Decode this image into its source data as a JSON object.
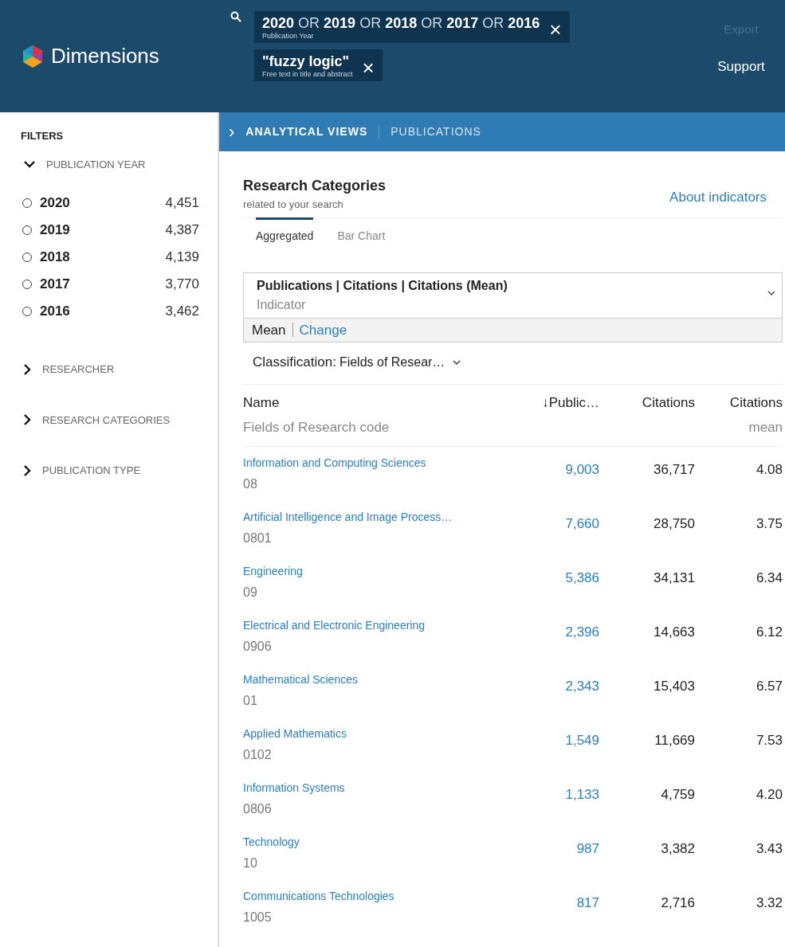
{
  "header": {
    "logo": "Dimensions",
    "search_chips": [
      {
        "query": "**2020** OR **2019** OR **2018** OR **2017** OR **2016**",
        "caption": "Publication Year",
        "remove": "×"
      },
      {
        "query": "\"fuzzy logic\"",
        "caption": "Free text in title and abstract",
        "remove": "×"
      }
    ],
    "links": [
      {
        "label": "Export",
        "disabled": true
      },
      {
        "label": "Support",
        "disabled": false
      }
    ]
  },
  "breadcrumb": {
    "toggle": "›",
    "items": [
      "ANALYTICAL VIEWS",
      "PUBLICATIONS"
    ]
  },
  "sidebar": {
    "title": "FILTERS",
    "sections": [
      {
        "label": "PUBLICATION YEAR",
        "expanded": true,
        "items": [
          {
            "label": "2020",
            "count": "4,451",
            "checked": false
          },
          {
            "label": "2019",
            "count": "4,387",
            "checked": false
          },
          {
            "label": "2018",
            "count": "4,139",
            "checked": false
          },
          {
            "label": "2017",
            "count": "3,770",
            "checked": false
          },
          {
            "label": "2016",
            "count": "3,462",
            "checked": false
          }
        ]
      },
      {
        "label": "RESEARCHER",
        "expanded": false
      },
      {
        "label": "RESEARCH CATEGORIES",
        "expanded": false
      },
      {
        "label": "PUBLICATION TYPE",
        "expanded": false
      }
    ]
  },
  "panel": {
    "title": "Research Categories",
    "subtitle": "related to your search",
    "about_link": "About indicators",
    "tabs": [
      {
        "label": "Aggregated",
        "selected": true
      },
      {
        "label": "Bar Chart",
        "selected": false
      }
    ],
    "indicator": {
      "value": "Publications | Citations | Citations (Mean)",
      "label": "Indicator",
      "mode": "Mean",
      "change": "Change"
    },
    "classification": {
      "label": "Classification:",
      "value": "Fields of Resear…"
    },
    "table": {
      "columns": [
        {
          "title": "Name",
          "subtitle": "Fields of Research code"
        },
        {
          "title": "↓Public…"
        },
        {
          "title": "Citations"
        },
        {
          "title": "Citations",
          "subtitle": "mean"
        }
      ],
      "rows": [
        {
          "name": "Information and Computing Sciences",
          "code": "08",
          "publications": "9,003",
          "citations": "36,717",
          "mean": "4.08"
        },
        {
          "name": "Artificial Intelligence and Image Process…",
          "code": "0801",
          "publications": "7,660",
          "citations": "28,750",
          "mean": "3.75"
        },
        {
          "name": "Engineering",
          "code": "09",
          "publications": "5,386",
          "citations": "34,131",
          "mean": "6.34"
        },
        {
          "name": "Electrical and Electronic Engineering",
          "code": "0906",
          "publications": "2,396",
          "citations": "14,663",
          "mean": "6.12"
        },
        {
          "name": "Mathematical Sciences",
          "code": "01",
          "publications": "2,343",
          "citations": "15,403",
          "mean": "6.57"
        },
        {
          "name": "Applied Mathematics",
          "code": "0102",
          "publications": "1,549",
          "citations": "11,669",
          "mean": "7.53"
        },
        {
          "name": "Information Systems",
          "code": "0806",
          "publications": "1,133",
          "citations": "4,759",
          "mean": "4.20"
        },
        {
          "name": "Technology",
          "code": "10",
          "publications": "987",
          "citations": "3,382",
          "mean": "3.43"
        },
        {
          "name": "Communications Technologies",
          "code": "1005",
          "publications": "817",
          "citations": "2,716",
          "mean": "3.32"
        }
      ]
    }
  }
}
